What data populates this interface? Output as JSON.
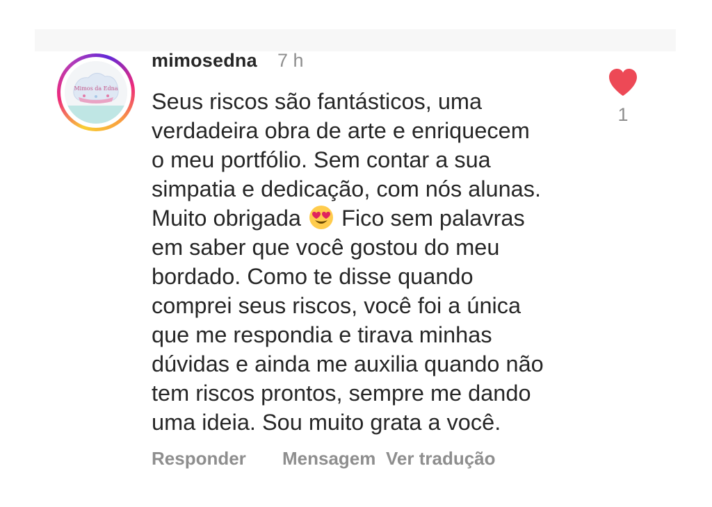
{
  "comment": {
    "username": "mimosedna",
    "time": "7 h",
    "avatar_label": "Mimos da Edna",
    "lines": [
      "Seus riscos são fantásticos, uma",
      "verdadeira obra de arte e enriquecem",
      "o meu portfólio. Sem contar a sua",
      "simpatia e dedicação, com nós alunas."
    ],
    "emoji_line": {
      "before": "Muito obrigada",
      "emoji_icon": "heart-eyes-emoji",
      "after": "Fico sem palavras"
    },
    "lines_after": [
      "em saber que você gostou do meu",
      "bordado. Como te disse quando",
      "comprei seus riscos, você foi a única",
      "que me respondia e tirava minhas",
      "dúvidas e ainda me auxilia quando não",
      "tem riscos prontos, sempre me dando",
      "uma ideia. Sou muito grata a você."
    ],
    "like_count": "1",
    "like_icon": "heart-icon",
    "like_color": "#ed4956"
  },
  "actions": {
    "reply_label": "Responder",
    "message_label": "Mensagem",
    "translate_label": "Ver tradução"
  },
  "colors": {
    "text": "#262626",
    "secondary": "#8e8e8e",
    "topbar": "#f7f7f7"
  }
}
